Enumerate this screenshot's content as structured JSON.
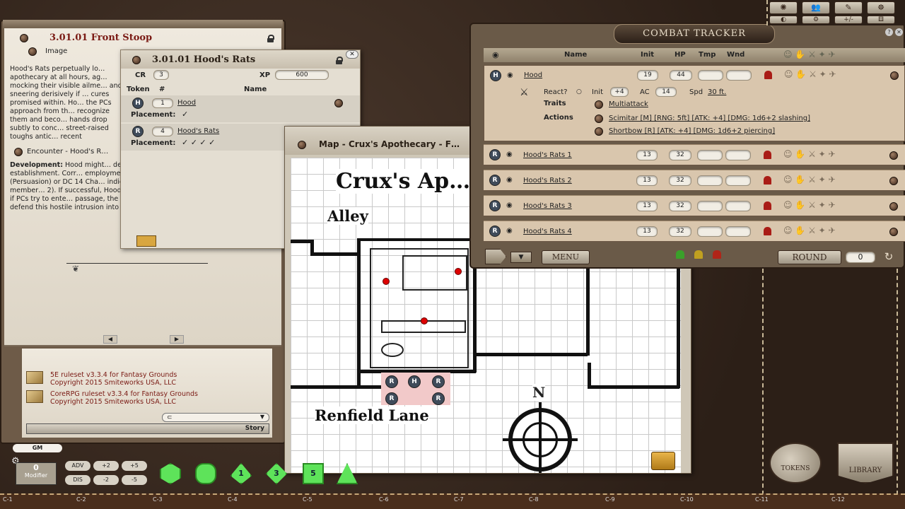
{
  "story": {
    "title": "3.01.01 Front Stoop",
    "image_label": "Image",
    "paragraph1": "Hood's Rats perpetually lo… apothecary at all hours, ag… mocking their visible ailme… and sneering derisively if … cures promised within. Ho… the PCs approach from th… recognize them and beco… hands drop subtly to conc… street-raised toughs antic… recent shenanigans.",
    "encounter_label": "Encounter - Hood's R…",
    "dev_label": "Development:",
    "paragraph2": "Hood might… derisive parlay, seeking to… boss's establishment. Corr… employment, Hood is bor… to coerce an introduction… (Persuasion) or DC 14 Cha… indicating the increased d… three of his gang member… 2). If successful, Hood beg… allow PCs to enter the sho… more, or if PCs try to ente… passage, the gang members draw their weapons to defend this hostile intrusion into their territory."
  },
  "library": {
    "items": [
      {
        "line1": "5E ruleset v3.3.4 for Fantasy Grounds",
        "line2": "Copyright 2015 Smiteworks USA, LLC"
      },
      {
        "line1": "CoreRPG ruleset v3.3.4 for Fantasy Grounds",
        "line2": "Copyright 2015 Smiteworks USA, LLC"
      }
    ],
    "story_button": "Story"
  },
  "encounter": {
    "title": "3.01.01 Hood's Rats",
    "cr_label": "CR",
    "cr_value": "3",
    "xp_label": "XP",
    "xp_value": "600",
    "col_token": "Token",
    "col_num": "#",
    "col_name": "Name",
    "rows": [
      {
        "token": "H",
        "count": "1",
        "name": "Hood",
        "placement_label": "Placement:"
      },
      {
        "token": "R",
        "count": "4",
        "name": "Hood's Rats",
        "placement_label": "Placement:"
      }
    ]
  },
  "map": {
    "window_title": "Map - Crux's Apothecary - F…",
    "title": "Crux's Ap…",
    "alley": "Alley",
    "street": "Renfield Lane",
    "north": "N",
    "tokens": [
      "R",
      "H",
      "R",
      "R",
      "R"
    ]
  },
  "combat": {
    "title": "COMBAT TRACKER",
    "col_name": "Name",
    "col_init": "Init",
    "col_hp": "HP",
    "col_tmp": "Tmp",
    "col_wnd": "Wnd",
    "hood": {
      "token": "H",
      "name": "Hood",
      "init": "19",
      "hp": "44",
      "react_label": "React?",
      "init_label": "Init",
      "init_mod": "+4",
      "ac_label": "AC",
      "ac": "14",
      "spd_label": "Spd",
      "spd": "30 ft.",
      "traits_label": "Traits",
      "trait": "Multiattack",
      "actions_label": "Actions",
      "action1": "Scimitar [M] [RNG: 5ft] [ATK: +4] [DMG: 1d6+2 slashing]",
      "action2": "Shortbow [R] [ATK: +4] [DMG: 1d6+2 piercing]"
    },
    "rats": [
      {
        "token": "R",
        "name": "Hood's Rats 1",
        "init": "13",
        "hp": "32"
      },
      {
        "token": "R",
        "name": "Hood's Rats 2",
        "init": "13",
        "hp": "32"
      },
      {
        "token": "R",
        "name": "Hood's Rats 3",
        "init": "13",
        "hp": "32"
      },
      {
        "token": "R",
        "name": "Hood's Rats 4",
        "init": "13",
        "hp": "32"
      }
    ],
    "menu_button": "MENU",
    "round_label": "ROUND",
    "round_value": "0"
  },
  "bottom": {
    "gm_label": "GM",
    "modifier_value": "0",
    "modifier_label": "Modifier",
    "mod_buttons": [
      "ADV",
      "+2",
      "+5",
      "DIS",
      "-2",
      "-5"
    ],
    "dice": [
      "",
      "",
      "1",
      "3",
      "5",
      ""
    ],
    "tokens_button": "TOKENS",
    "library_button": "LIBRARY",
    "coords": [
      "C-1",
      "C-2",
      "C-3",
      "C-4",
      "C-5",
      "C-6",
      "C-7",
      "C-8",
      "C-9",
      "C-10",
      "C-11",
      "C-12"
    ]
  },
  "toolbar": {
    "undo": "+/-"
  }
}
